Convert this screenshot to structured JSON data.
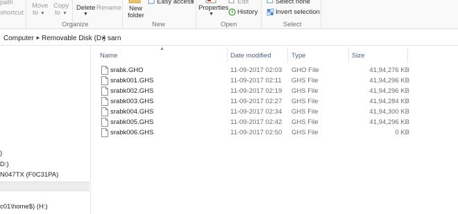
{
  "ribbon": {
    "clipboard": {
      "path_label": "path",
      "shortcut_label": "shortcut"
    },
    "organize": {
      "move_to_line1": "Move",
      "move_to_line2": "to",
      "copy_to_line1": "Copy",
      "copy_to_line2": "to",
      "delete_label": "Delete",
      "rename_label": "Rename",
      "group_label": "Organize"
    },
    "new": {
      "new_folder_line1": "New",
      "new_folder_line2": "folder",
      "easy_access_label": "Easy access",
      "group_label": "New"
    },
    "open": {
      "properties_label": "Properties",
      "edit_label": "Edit",
      "history_label": "History",
      "group_label": "Open"
    },
    "select": {
      "select_none_label": "Select none",
      "invert_selection_label": "Invert selection",
      "group_label": "Select"
    }
  },
  "address": {
    "crumbs": [
      "Computer",
      "Removable Disk (D:)",
      "sarn"
    ]
  },
  "nav": {
    "items": [
      ")",
      "D:)",
      "N047TX (F0C31PA)",
      "c01\\home$) (H:)"
    ]
  },
  "columns": {
    "name": "Name",
    "date": "Date modified",
    "type": "Type",
    "size": "Size"
  },
  "files": [
    {
      "name": "srabk.GHO",
      "date": "11-09-2017 02:03",
      "type": "GHO File",
      "size": "41,94,276 KB"
    },
    {
      "name": "srabk001.GHS",
      "date": "11-09-2017 02:11",
      "type": "GHS File",
      "size": "41,94,296 KB"
    },
    {
      "name": "srabk002.GHS",
      "date": "11-09-2017 02:19",
      "type": "GHS File",
      "size": "41,94,296 KB"
    },
    {
      "name": "srabk003.GHS",
      "date": "11-09-2017 02:27",
      "type": "GHS File",
      "size": "41,94,284 KB"
    },
    {
      "name": "srabk004.GHS",
      "date": "11-09-2017 02:34",
      "type": "GHS File",
      "size": "41,94,300 KB"
    },
    {
      "name": "srabk005.GHS",
      "date": "11-09-2017 02:42",
      "type": "GHS File",
      "size": "41,94,296 KB"
    },
    {
      "name": "srabk006.GHS",
      "date": "11-09-2017 02:50",
      "type": "GHS File",
      "size": "0 KB"
    }
  ]
}
